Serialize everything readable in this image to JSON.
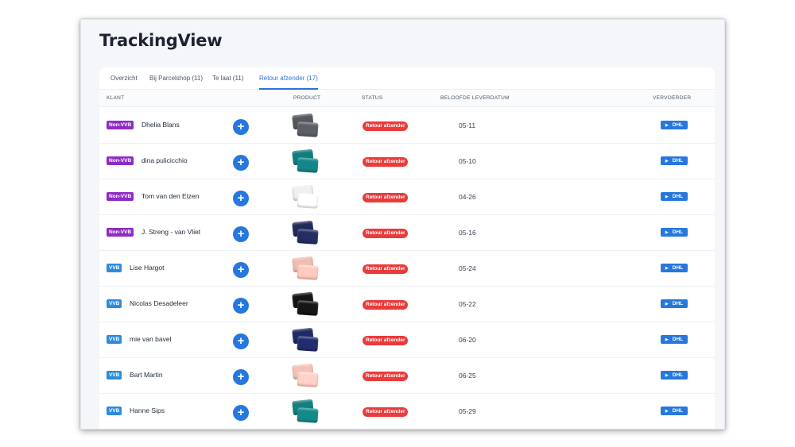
{
  "app": {
    "title": "TrackingView"
  },
  "tabs": [
    {
      "label": "Overzicht",
      "active": false
    },
    {
      "label": "Bij Parcelshop (11)",
      "active": false
    },
    {
      "label": "Te laat (11)",
      "active": false
    },
    {
      "label": "Retour afzender (17)",
      "active": true
    }
  ],
  "table": {
    "headers": {
      "klant": "KLANT",
      "product": "PRODUCT",
      "status": "STATUS",
      "leverdatum": "BELOOFDE LEVERDATUM",
      "vervoerder": "VERVOERDER"
    },
    "rows": [
      {
        "tag": "Non-VVB",
        "tag_type": "nonvvb",
        "name": "Dhelia Blans",
        "product_color": "#55585e",
        "status": "Retour afzender",
        "date": "05-11",
        "carrier": "DHL"
      },
      {
        "tag": "Non-VVB",
        "tag_type": "nonvvb",
        "name": "dina pulicicchio",
        "product_color": "#127d7f",
        "status": "Retour afzender",
        "date": "05-10",
        "carrier": "DHL"
      },
      {
        "tag": "Non-VVB",
        "tag_type": "nonvvb",
        "name": "Tom van den Elzen",
        "product_color": "#eef0f2",
        "status": "Retour afzender",
        "date": "04-26",
        "carrier": "DHL"
      },
      {
        "tag": "Non-VVB",
        "tag_type": "nonvvb",
        "name": "J. Streng - van Vliet",
        "product_color": "#222a5a",
        "status": "Retour afzender",
        "date": "05-16",
        "carrier": "DHL"
      },
      {
        "tag": "VVB",
        "tag_type": "vvb",
        "name": "Lise Hargot",
        "product_color": "#f2bcb0",
        "status": "Retour afzender",
        "date": "05-24",
        "carrier": "DHL"
      },
      {
        "tag": "VVB",
        "tag_type": "vvb",
        "name": "Nicolas Desadeleer",
        "product_color": "#141414",
        "status": "Retour afzender",
        "date": "05-22",
        "carrier": "DHL"
      },
      {
        "tag": "VVB",
        "tag_type": "vvb",
        "name": "mie van bavel",
        "product_color": "#1f2a66",
        "status": "Retour afzender",
        "date": "06-20",
        "carrier": "DHL"
      },
      {
        "tag": "VVB",
        "tag_type": "vvb",
        "name": "Bart Martin",
        "product_color": "#f3c2b6",
        "status": "Retour afzender",
        "date": "06-25",
        "carrier": "DHL"
      },
      {
        "tag": "VVB",
        "tag_type": "vvb",
        "name": "Hanne Sips",
        "product_color": "#13807f",
        "status": "Retour afzender",
        "date": "05-29",
        "carrier": "DHL"
      }
    ]
  },
  "icons": {
    "add": "plus-circle-icon",
    "carrier_arrow": "caret-right-icon"
  },
  "colors": {
    "accent": "#2677de",
    "status_red": "#ea3b3b",
    "tag_nonvvb": "#8e2bc4",
    "tag_vvb": "#2c8be0"
  }
}
